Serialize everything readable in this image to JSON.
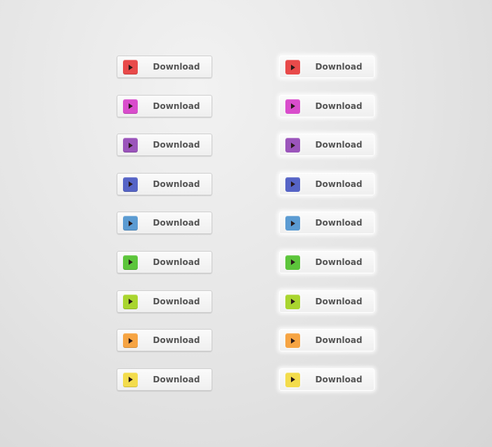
{
  "button_label": "Download",
  "colors": [
    "#e84a4a",
    "#d94dcc",
    "#9b55bb",
    "#5664c6",
    "#5b9bd2",
    "#5cc53b",
    "#a9d52f",
    "#f6a443",
    "#f3dc4c"
  ],
  "columns": [
    {
      "style": "flat"
    },
    {
      "style": "glow"
    }
  ]
}
